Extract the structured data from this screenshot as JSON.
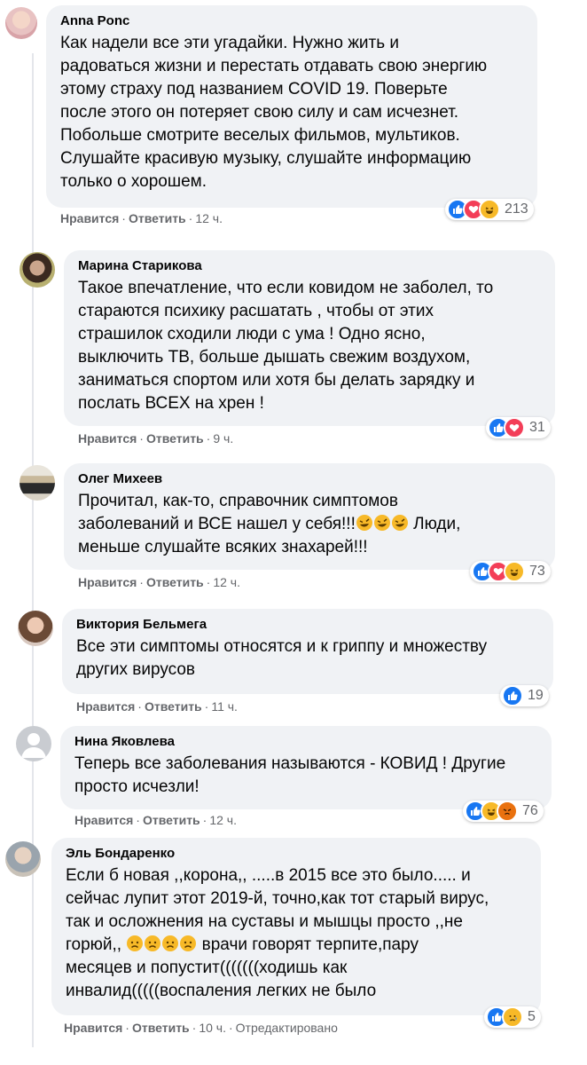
{
  "actions": {
    "like": "Нравится",
    "reply": "Ответить",
    "edited": "Отредактировано"
  },
  "colors": {
    "bubble": "#f0f2f5",
    "like_blue": "#1877f2",
    "love_red": "#f33e58",
    "haha_yellow": "#f7b928",
    "angry_orange": "#e9710f",
    "meta_text": "#65676b"
  },
  "comments": [
    {
      "author": "Anna Ponc",
      "text": "Как надели все эти угадайки. Нужно жить и\nрадоваться жизни и перестать отдавать свою энергию\nэтому страху под названием COVID 19. Поверьте\nпосле этого он потеряет свою силу и сам исчезнет.\nПобольше смотрите веселых фильмов, мультиков.\nСлушайте красивую музыку, слушайте информацию\nтолько о хорошем.",
      "time": "12 ч.",
      "reactions": [
        "like",
        "love",
        "haha"
      ],
      "reaction_count": "213"
    },
    {
      "author": "Марина Старикова",
      "text": "Такое впечатление, что если ковидом не заболел, то\nстараются психику расшатать , чтобы от этих\nстрашилок сходили люди с ума ! Одно ясно,\nвыключить ТВ, больше дышать свежим воздухом,\nзаниматься спортом или хотя бы делать зарядку и\nпослать ВСЕХ на хрен !",
      "time": "9 ч.",
      "reactions": [
        "like",
        "love"
      ],
      "reaction_count": "31"
    },
    {
      "author": "Олег Михеев",
      "text_lines": [
        "Прочитал, как-то, справочник симптомов",
        "заболеваний и ВСЕ нашел у себя!!!",
        "Люди,",
        "меньше слушайте всяких знахарей!!!"
      ],
      "inline_emoji": [
        "rofl-emoji",
        "rofl-emoji",
        "rofl-emoji"
      ],
      "time": "12 ч.",
      "reactions": [
        "like",
        "love",
        "haha"
      ],
      "reaction_count": "73"
    },
    {
      "author": "Виктория Бельмега",
      "text": "Все эти симптомы относятся и к гриппу и множеству\nдругих вирусов",
      "time": "11 ч.",
      "reactions": [
        "like"
      ],
      "reaction_count": "19"
    },
    {
      "author": "Нина Яковлева",
      "text": "Теперь все заболевания называются - КОВИД ! Другие\nпросто исчезли!",
      "time": "12 ч.",
      "reactions": [
        "like",
        "haha",
        "angry"
      ],
      "reaction_count": "76"
    },
    {
      "author": "Эль Бондаренко",
      "text_lines": [
        "Если б новая ,,корона,, .....в 2015 все это было..... и",
        "сейчас лупит этот 2019-й, точно,как тот старый вирус,",
        "так и осложнения на суставы и мышцы просто ,,не",
        "горюй,,",
        "врачи говорят терпите,пару",
        "месяцев и попустит(((((((ходишь как",
        "инвалид(((((воспаления легких не было"
      ],
      "inline_emoji": [
        "sad-emoji",
        "sad-emoji",
        "sad-emoji",
        "sad-emoji"
      ],
      "time": "10 ч.",
      "reactions": [
        "like",
        "sad"
      ],
      "reaction_count": "5"
    }
  ]
}
